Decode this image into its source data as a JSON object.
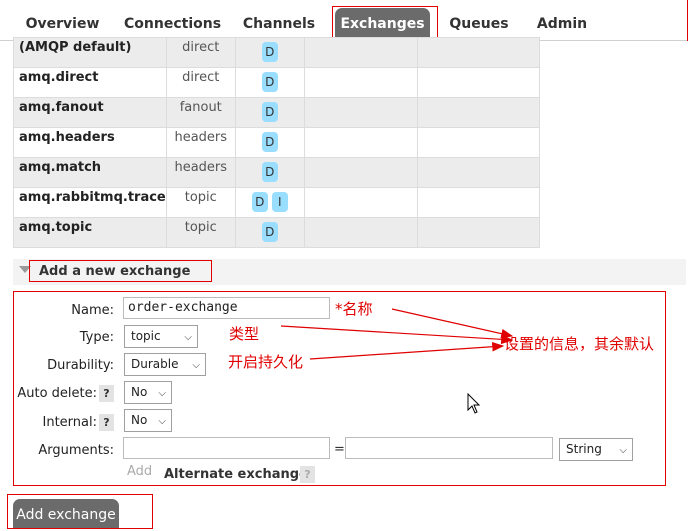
{
  "nav": {
    "tabs": [
      {
        "label": "Overview"
      },
      {
        "label": "Connections"
      },
      {
        "label": "Channels"
      },
      {
        "label": "Exchanges",
        "active": true
      },
      {
        "label": "Queues"
      },
      {
        "label": "Admin"
      }
    ]
  },
  "exchanges": [
    {
      "name": "(AMQP default)",
      "type": "direct",
      "features": [
        "D"
      ]
    },
    {
      "name": "amq.direct",
      "type": "direct",
      "features": [
        "D"
      ]
    },
    {
      "name": "amq.fanout",
      "type": "fanout",
      "features": [
        "D"
      ]
    },
    {
      "name": "amq.headers",
      "type": "headers",
      "features": [
        "D"
      ]
    },
    {
      "name": "amq.match",
      "type": "headers",
      "features": [
        "D"
      ]
    },
    {
      "name": "amq.rabbitmq.trace",
      "type": "topic",
      "features": [
        "D",
        "I"
      ]
    },
    {
      "name": "amq.topic",
      "type": "topic",
      "features": [
        "D"
      ]
    }
  ],
  "add_section": {
    "title": "Add a new exchange",
    "name_label": "Name:",
    "name_value": "order-exchange",
    "type_label": "Type:",
    "type_value": "topic",
    "durability_label": "Durability:",
    "durability_value": "Durable",
    "auto_delete_label": "Auto delete:",
    "auto_delete_value": "No",
    "internal_label": "Internal:",
    "internal_value": "No",
    "arguments_label": "Arguments:",
    "arguments_equals": "=",
    "arguments_type_value": "String",
    "add_link": "Add",
    "alternate_exchange": "Alternate exchange",
    "help_glyph": "?",
    "submit_label": "Add exchange"
  },
  "annotations": {
    "name_note": "*名称",
    "type_note": "类型",
    "durable_note": "开启持久化",
    "summary_note": "设置的信息，其余默认",
    "color": "#e00000"
  },
  "icons": {
    "dropdown": "chevron-down-icon",
    "help": "question-icon",
    "collapse": "triangle-down-icon"
  }
}
